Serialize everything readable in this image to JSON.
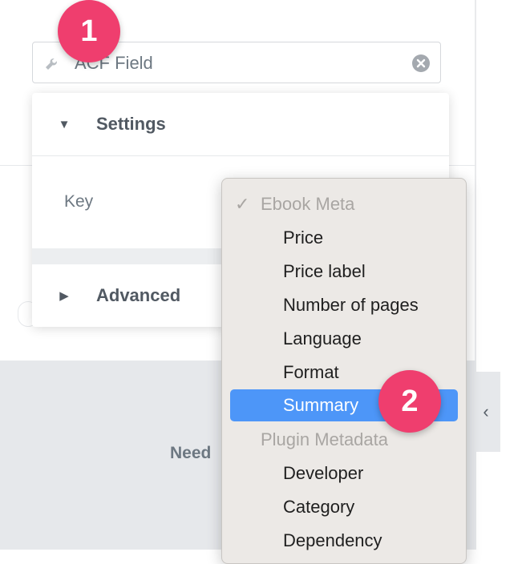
{
  "search": {
    "value": "ACF Field"
  },
  "settings_popover": {
    "settings_title": "Settings",
    "key_label": "Key",
    "advanced_title": "Advanced"
  },
  "background": {
    "need_text": "Need"
  },
  "dropdown": {
    "groups": [
      {
        "label": "Ebook Meta",
        "checked": true,
        "items": [
          "Price",
          "Price label",
          "Number of pages",
          "Language",
          "Format",
          "Summary"
        ]
      },
      {
        "label": "Plugin Metadata",
        "checked": false,
        "items": [
          "Developer",
          "Category",
          "Dependency"
        ]
      }
    ],
    "rows": [
      {
        "label": "Ebook Meta"
      },
      {
        "label": "Price"
      },
      {
        "label": "Price label"
      },
      {
        "label": "Number of pages"
      },
      {
        "label": "Language"
      },
      {
        "label": "Format"
      },
      {
        "label": "Summary"
      },
      {
        "label": "Plugin Metadata"
      },
      {
        "label": "Developer"
      },
      {
        "label": "Category"
      },
      {
        "label": "Dependency"
      }
    ],
    "selected_item": "Summary",
    "checkmark_glyph": "✓"
  },
  "badges": {
    "step1": "1",
    "step2": "2"
  },
  "colors": {
    "badge": "#ef3e6e",
    "selection": "#4d96f8",
    "menu_bg": "#ece9e6"
  },
  "icons": {
    "field_icon": "wrench-icon",
    "clear_icon": "clear-circle-icon",
    "collapse_icon": "chevron-left-icon"
  }
}
